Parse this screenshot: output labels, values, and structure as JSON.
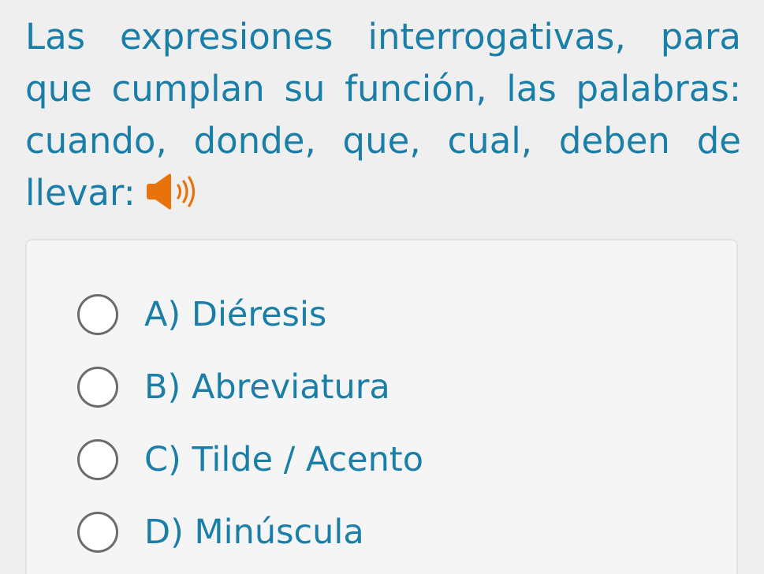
{
  "question": {
    "text": "Las expresiones interrogativas, para que cumplan su función, las palabras: cuando, donde, que, cual, deben de llevar:",
    "audio_icon": "speaker-icon",
    "text_color": "#1a7fa8",
    "audio_color": "#e8730c"
  },
  "options": [
    {
      "label": "A) Diéresis"
    },
    {
      "label": "B) Abreviatura"
    },
    {
      "label": "C) Tilde / Acento"
    },
    {
      "label": "D) Minúscula"
    }
  ]
}
